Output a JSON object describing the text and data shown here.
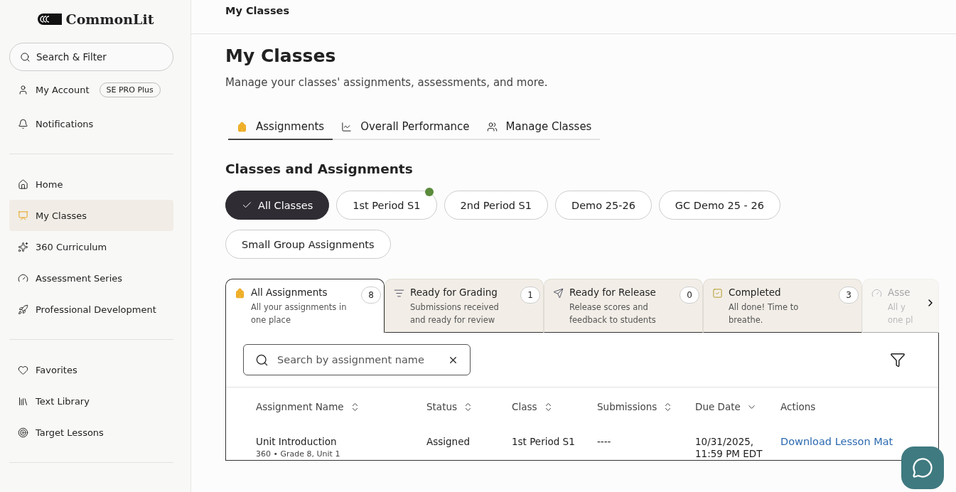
{
  "logo": "CommonLit",
  "sidebar": {
    "search": {
      "placeholder": "Search & Filter"
    },
    "account": {
      "label": "My Account",
      "badge": "SE PRO Plus"
    },
    "notifications": {
      "label": "Notifications"
    },
    "groups": [
      {
        "items": [
          {
            "label": "Home",
            "selected": false
          },
          {
            "label": "My Classes",
            "selected": true
          },
          {
            "label": "360 Curriculum",
            "selected": false
          },
          {
            "label": "Assessment Series",
            "selected": false
          },
          {
            "label": "Professional Development",
            "selected": false
          }
        ]
      },
      {
        "items": [
          {
            "label": "Favorites",
            "selected": false
          },
          {
            "label": "Text Library",
            "selected": false
          },
          {
            "label": "Target Lessons",
            "selected": false
          }
        ]
      }
    ]
  },
  "breadcrumb": "My Classes",
  "page_title": "My Classes",
  "subtitle": "Manage your classes' assignments, assessments, and more.",
  "tabs": [
    {
      "label": "Assignments",
      "selected": true
    },
    {
      "label": "Overall Performance",
      "selected": false
    },
    {
      "label": "Manage Classes",
      "selected": false
    }
  ],
  "section_title": "Classes and Assignments",
  "class_chips": [
    {
      "label": "All Classes",
      "selected": true,
      "dot": false
    },
    {
      "label": "1st Period S1",
      "selected": false,
      "dot": true
    },
    {
      "label": "2nd Period S1",
      "selected": false,
      "dot": false
    },
    {
      "label": "Demo 25-26",
      "selected": false,
      "dot": false
    },
    {
      "label": "GC Demo 25 - 26",
      "selected": false,
      "dot": false
    },
    {
      "label": "Small Group Assignments",
      "selected": false,
      "dot": false
    }
  ],
  "status_tabs": [
    {
      "title": "All Assignments",
      "description": "All your assignments in one place",
      "count": "8",
      "selected": true
    },
    {
      "title": "Ready for Grading",
      "description": "Submissions received and ready for review",
      "count": "1",
      "selected": false
    },
    {
      "title": "Ready for Release",
      "description": "Release scores and feedback to students",
      "count": "0",
      "selected": false
    },
    {
      "title": "Completed",
      "description": "All done! Time to breathe.",
      "count": "3",
      "selected": false
    },
    {
      "title": "Asse",
      "description": "All y one pl",
      "selected": false
    }
  ],
  "assignment_search": {
    "placeholder": "Search by assignment name"
  },
  "table": {
    "columns": [
      {
        "label": "Assignment Name",
        "kind": "sortable"
      },
      {
        "label": "Status",
        "kind": "sortable"
      },
      {
        "label": "Class",
        "kind": "sortable"
      },
      {
        "label": "Submissions",
        "kind": "sortable"
      },
      {
        "label": "Due Date",
        "kind": "sorted"
      },
      {
        "label": "Actions",
        "kind": "plain"
      }
    ],
    "rows": [
      {
        "name": "Unit Introduction",
        "subtitle": "360 • Grade 8, Unit 1",
        "status": "Assigned",
        "class": "1st Period S1",
        "submissions": "----",
        "due": "10/31/2025, 11:59 PM EDT",
        "action": "Download Lesson Mat"
      }
    ]
  }
}
